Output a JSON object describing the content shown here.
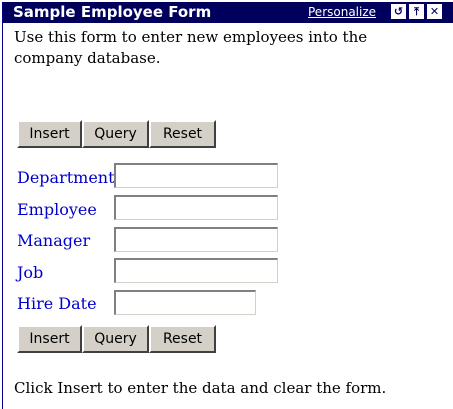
{
  "portlet": {
    "title": "Sample Employee Form",
    "personalize_label": "Personalize",
    "icons": {
      "refresh": "refresh-icon",
      "pin": "pin-icon",
      "close": "close-icon"
    }
  },
  "form": {
    "intro": "Use this form to enter new employees into the company database.",
    "buttons": {
      "insert": "Insert",
      "query": "Query",
      "reset": "Reset"
    },
    "fields": [
      {
        "label": "Department",
        "value": ""
      },
      {
        "label": "Employee",
        "value": ""
      },
      {
        "label": "Manager",
        "value": ""
      },
      {
        "label": "Job",
        "value": ""
      },
      {
        "label": "Hire Date",
        "value": ""
      }
    ],
    "footer": "Click Insert to enter the data and clear the form."
  },
  "colors": {
    "titlebar": "#00005c",
    "label": "#0000cc",
    "button_face": "#d4d0c8"
  }
}
